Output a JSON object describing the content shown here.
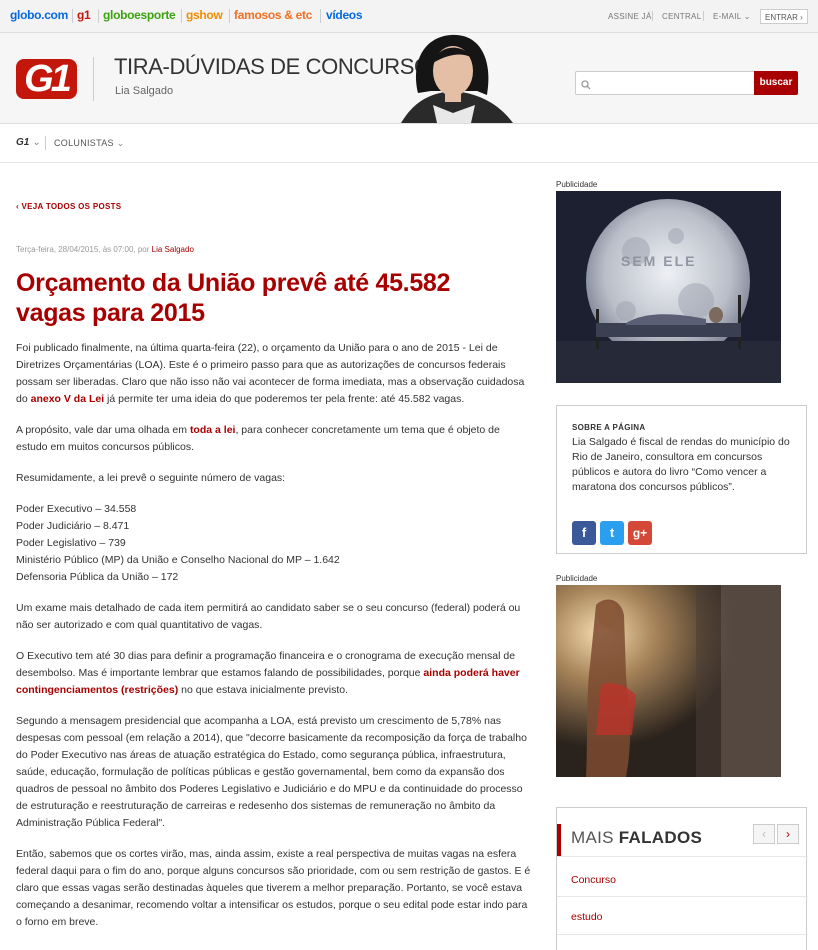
{
  "topbar": {
    "brands": [
      {
        "label": "globo.com",
        "color": "#0669de"
      },
      {
        "label": "g1",
        "color": "#c4170c"
      },
      {
        "label": "globoesporte",
        "color": "#3ca20e"
      },
      {
        "label": "gshow",
        "color": "#f08c00"
      },
      {
        "label": "famosos & etc",
        "color": "#f26f21"
      },
      {
        "label": "vídeos",
        "color": "#0669de"
      }
    ],
    "assine": "ASSINE JÁ",
    "central": "CENTRAL",
    "email": "E-MAIL",
    "entrar": "ENTRAR"
  },
  "header": {
    "logo": "G1",
    "title": "TIRA-DÚVIDAS DE CONCURSOS",
    "author": "Lia Salgado",
    "search_placeholder": "",
    "search_button": "buscar"
  },
  "nav": {
    "g1": "G1",
    "colunistas": "COLUNISTAS"
  },
  "article": {
    "back": "VEJA TODOS OS POSTS",
    "meta_date": "Terça-feira, 28/04/2015, às 07:00, por ",
    "meta_author": "Lia Salgado",
    "headline": "Orçamento da União prevê até 45.582 vagas para 2015",
    "p1_a": "Foi publicado finalmente, na última quarta-feira (22), o orçamento da União para o ano de 2015 - Lei de Diretrizes Orçamentárias (LOA). Este é o primeiro passo para que as autorizações de concursos federais possam ser liberadas. Claro que não isso não vai acontecer de forma imediata, mas a observação cuidadosa do ",
    "p1_link": "anexo V da Lei",
    "p1_b": " já permite ter uma ideia do que poderemos ter pela frente: até 45.582 vagas.",
    "p2_a": "A propósito, vale dar uma olhada em ",
    "p2_link": "toda a lei",
    "p2_b": ", para conhecer concretamente um tema que é objeto de estudo em muitos concursos públicos.",
    "p3": "Resumidamente, a lei prevê o seguinte número de vagas:",
    "list": [
      "Poder Executivo – 34.558",
      "Poder Judiciário – 8.471",
      "Poder Legislativo – 739",
      "Ministério Público (MP) da União e Conselho Nacional do MP – 1.642",
      "Defensoria Pública da União – 172"
    ],
    "p4": "Um exame mais detalhado de cada item permitirá ao candidato saber se o seu concurso (federal) poderá ou não ser autorizado e com qual quantitativo de vagas.",
    "p5_a": "O Executivo tem até 30 dias para definir a programação financeira e o cronograma de execução mensal de desembolso. Mas é importante lembrar que estamos falando de possibilidades, porque ",
    "p5_link": "ainda poderá haver contingenciamentos (restrições)",
    "p5_b": " no que estava inicialmente previsto.",
    "p6": "Segundo a mensagem presidencial que acompanha a LOA, está previsto um crescimento de 5,78% nas despesas com pessoal (em relação a 2014), que \"decorre basicamente da recomposição da força de trabalho do Poder Executivo nas áreas de atuação estratégica do Estado, como segurança pública, infraestrutura, saúde, educação, formulação de políticas públicas e gestão governamental, bem como da expansão dos quadros de pessoal no âmbito dos Poderes Legislativo e Judiciário e do MPU e da continuidade do processo de estruturação e reestruturação de carreiras e redesenho dos sistemas de remuneração no âmbito da Administração Pública Federal\".",
    "p7": "Então, sabemos que os cortes virão, mas, ainda assim, existe a real perspectiva de muitas vagas na esfera federal daqui para o fim do ano, porque alguns concursos são prioridade, com ou sem restrição de gastos. E é claro que essas vagas serão destinadas àqueles que tiverem a melhor preparação. Portanto, se você estava começando a desanimar, recomendo voltar a intensificar os estudos, porque o seu edital pode estar indo para o forno em breve."
  },
  "sidebar": {
    "publicidade": "Publicidade",
    "ad1_text": "SEM ELE",
    "about_heading": "SOBRE A PÁGINA",
    "about_text": "Lia Salgado é fiscal de rendas do município do Rio de Janeiro, consultora em concursos públicos e autora do livro “Como vencer a maratona dos concursos públicos”.",
    "social": [
      {
        "icon": "facebook-icon",
        "glyph": "f",
        "color": "#3b5998"
      },
      {
        "icon": "twitter-icon",
        "glyph": "t",
        "color": "#2a9ff0"
      },
      {
        "icon": "googleplus-icon",
        "glyph": "g+",
        "color": "#d34836"
      }
    ],
    "mais_light": "MAIS ",
    "mais_bold": "FALADOS",
    "mais_items": [
      "Concurso",
      "estudo"
    ]
  }
}
